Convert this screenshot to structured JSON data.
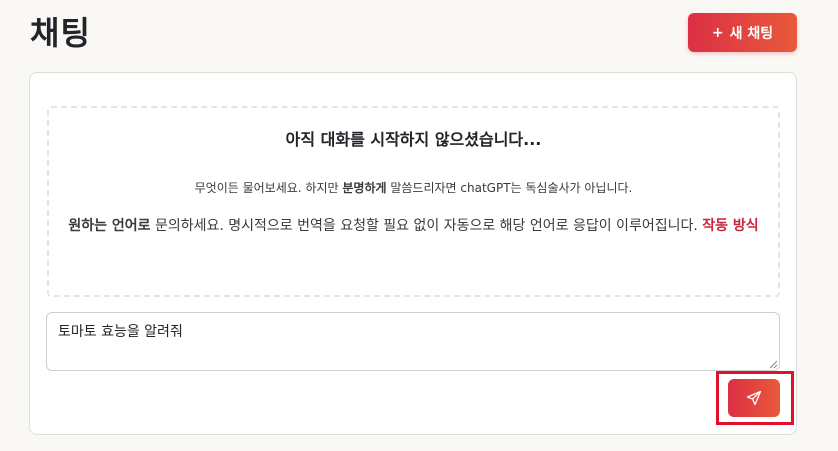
{
  "header": {
    "title": "채팅",
    "new_chat_icon": "+",
    "new_chat_label": "새 채팅"
  },
  "empty_state": {
    "title": "아직 대화를 시작하지 않으셨습니다...",
    "desc_pre": "무엇이든 물어보세요. 하지만 ",
    "desc_bold": "분명하게",
    "desc_post": " 말씀드리자면 chatGPT는 독심술사가 아닙니다.",
    "lang_bold": "원하는 언어로",
    "lang_text": " 문의하세요. 명시적으로 번역을 요청할 필요 없이 자동으로 해당 언어로 응답이 이루어집니다. ",
    "how_link": "작동 방식"
  },
  "composer": {
    "value": "토마토 효능을 알려줘",
    "send_icon": "paper-plane-icon"
  },
  "colors": {
    "accent": "#dc2f44",
    "accent_end": "#e85a3a",
    "highlight": "#e0112b",
    "link": "#c9263d"
  }
}
